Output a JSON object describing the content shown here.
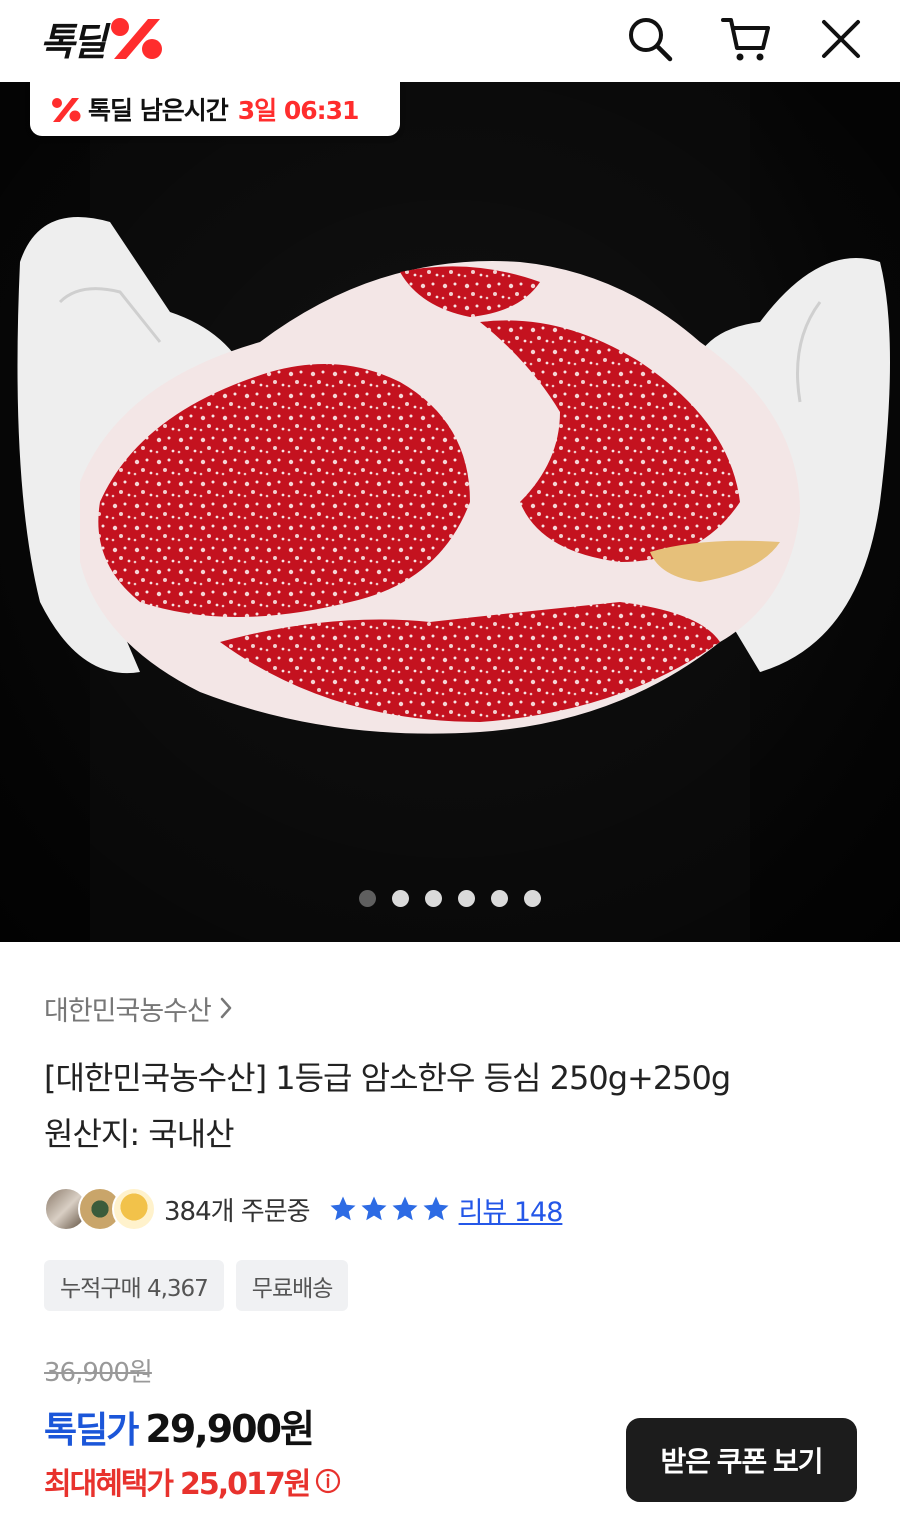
{
  "header": {
    "logo_text": "톡딜",
    "icons": [
      "search-icon",
      "cart-icon",
      "close-icon"
    ]
  },
  "hero": {
    "timer_label": "톡딜 남은시간",
    "timer_remaining": "3일 06:31",
    "slide_count": 6,
    "active_slide": 1
  },
  "product": {
    "seller": "대한민국농수산",
    "title": "[대한민국농수산] 1등급 암소한우 등심 250g+250g",
    "origin": "원산지: 국내산",
    "orders_text": "384개 주문중",
    "rating_stars": 4,
    "review_link": "리뷰 148",
    "tags": [
      "누적구매 4,367",
      "무료배송"
    ]
  },
  "price": {
    "original": "36,900원",
    "deal_label": "톡딜가",
    "deal_price": "29,900원",
    "max_label": "최대혜택가",
    "max_price": "25,017원"
  },
  "coupon_button": "받은 쿠폰 보기",
  "colors": {
    "brand_red": "#ff2d2d",
    "deal_blue": "#1b56d9",
    "max_red": "#e8322d",
    "star_blue": "#2d6be4"
  }
}
